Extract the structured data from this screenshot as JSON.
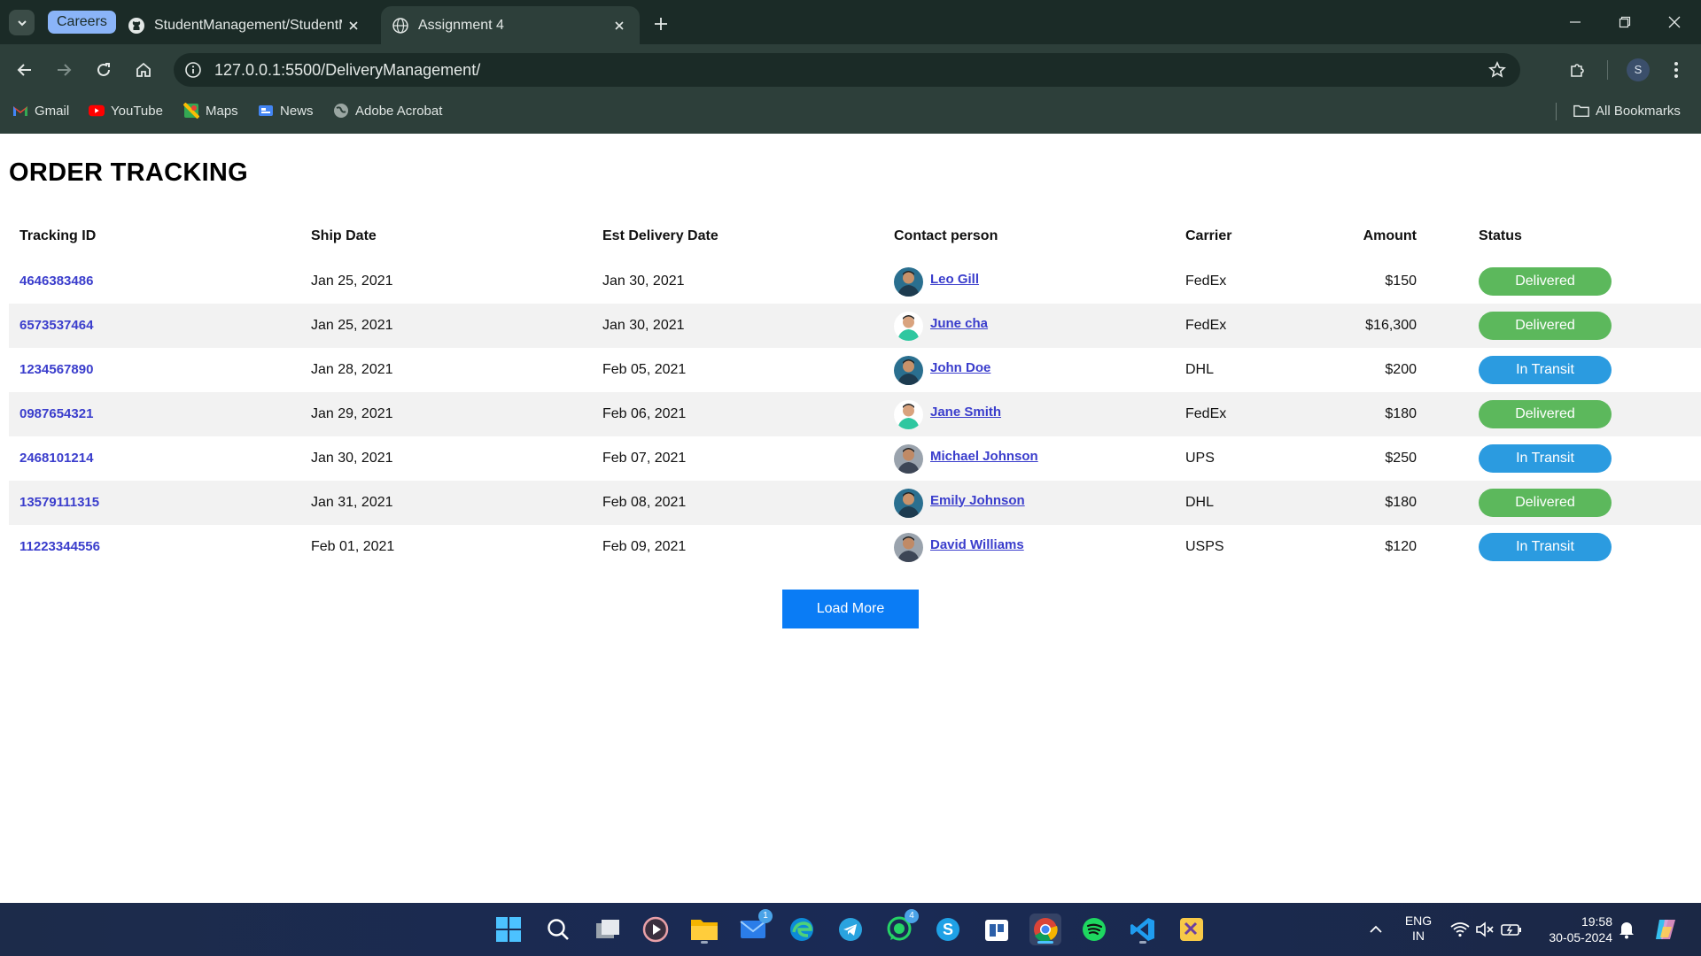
{
  "browser": {
    "tab_group_label": "Careers",
    "tabs": [
      {
        "title": "StudentManagement/StudentM",
        "active": false
      },
      {
        "title": "Assignment 4",
        "active": true
      }
    ],
    "url": "127.0.0.1:5500/DeliveryManagement/",
    "profile_initial": "S",
    "bookmarks": [
      "Gmail",
      "YouTube",
      "Maps",
      "News",
      "Adobe Acrobat"
    ],
    "all_bookmarks": "All Bookmarks"
  },
  "page": {
    "title": "ORDER TRACKING",
    "columns": [
      "Tracking ID",
      "Ship Date",
      "Est Delivery Date",
      "Contact person",
      "Carrier",
      "Amount",
      "Status"
    ],
    "rows": [
      {
        "id": "4646383486",
        "ship": "Jan 25, 2021",
        "est": "Jan 30, 2021",
        "contact": "Leo Gill",
        "carrier": "FedEx",
        "amount": "$150",
        "status": "Delivered"
      },
      {
        "id": "6573537464",
        "ship": "Jan 25, 2021",
        "est": "Jan 30, 2021",
        "contact": "June cha",
        "carrier": "FedEx",
        "amount": "$16,300",
        "status": "Delivered"
      },
      {
        "id": "1234567890",
        "ship": "Jan 28, 2021",
        "est": "Feb 05, 2021",
        "contact": "John Doe",
        "carrier": "DHL",
        "amount": "$200",
        "status": "In Transit"
      },
      {
        "id": "0987654321",
        "ship": "Jan 29, 2021",
        "est": "Feb 06, 2021",
        "contact": "Jane Smith",
        "carrier": "FedEx",
        "amount": "$180",
        "status": "Delivered"
      },
      {
        "id": "2468101214",
        "ship": "Jan 30, 2021",
        "est": "Feb 07, 2021",
        "contact": "Michael Johnson",
        "carrier": "UPS",
        "amount": "$250",
        "status": "In Transit"
      },
      {
        "id": "13579111315",
        "ship": "Jan 31, 2021",
        "est": "Feb 08, 2021",
        "contact": "Emily Johnson",
        "carrier": "DHL",
        "amount": "$180",
        "status": "Delivered"
      },
      {
        "id": "11223344556",
        "ship": "Feb 01, 2021",
        "est": "Feb 09, 2021",
        "contact": "David Williams",
        "carrier": "USPS",
        "amount": "$120",
        "status": "In Transit"
      }
    ],
    "load_more_label": "Load More"
  },
  "colors": {
    "link": "#3a3dcc",
    "delivered": "#5cb85c",
    "in_transit": "#2b9be0",
    "button": "#0a7cf5",
    "chrome_dark": "#1b2b27",
    "chrome_toolbar": "#2d3f3a"
  },
  "taskbar": {
    "apps": [
      "windows-start",
      "search",
      "task-view",
      "media-player",
      "file-explorer",
      "mail",
      "edge",
      "telegram",
      "whatsapp",
      "skype",
      "microsoft-store",
      "chrome",
      "spotify",
      "vscode",
      "snipping-tool"
    ],
    "mail_badge": "1",
    "whatsapp_badge": "4",
    "language_line1": "ENG",
    "language_line2": "IN",
    "time": "19:58",
    "date": "30-05-2024"
  }
}
